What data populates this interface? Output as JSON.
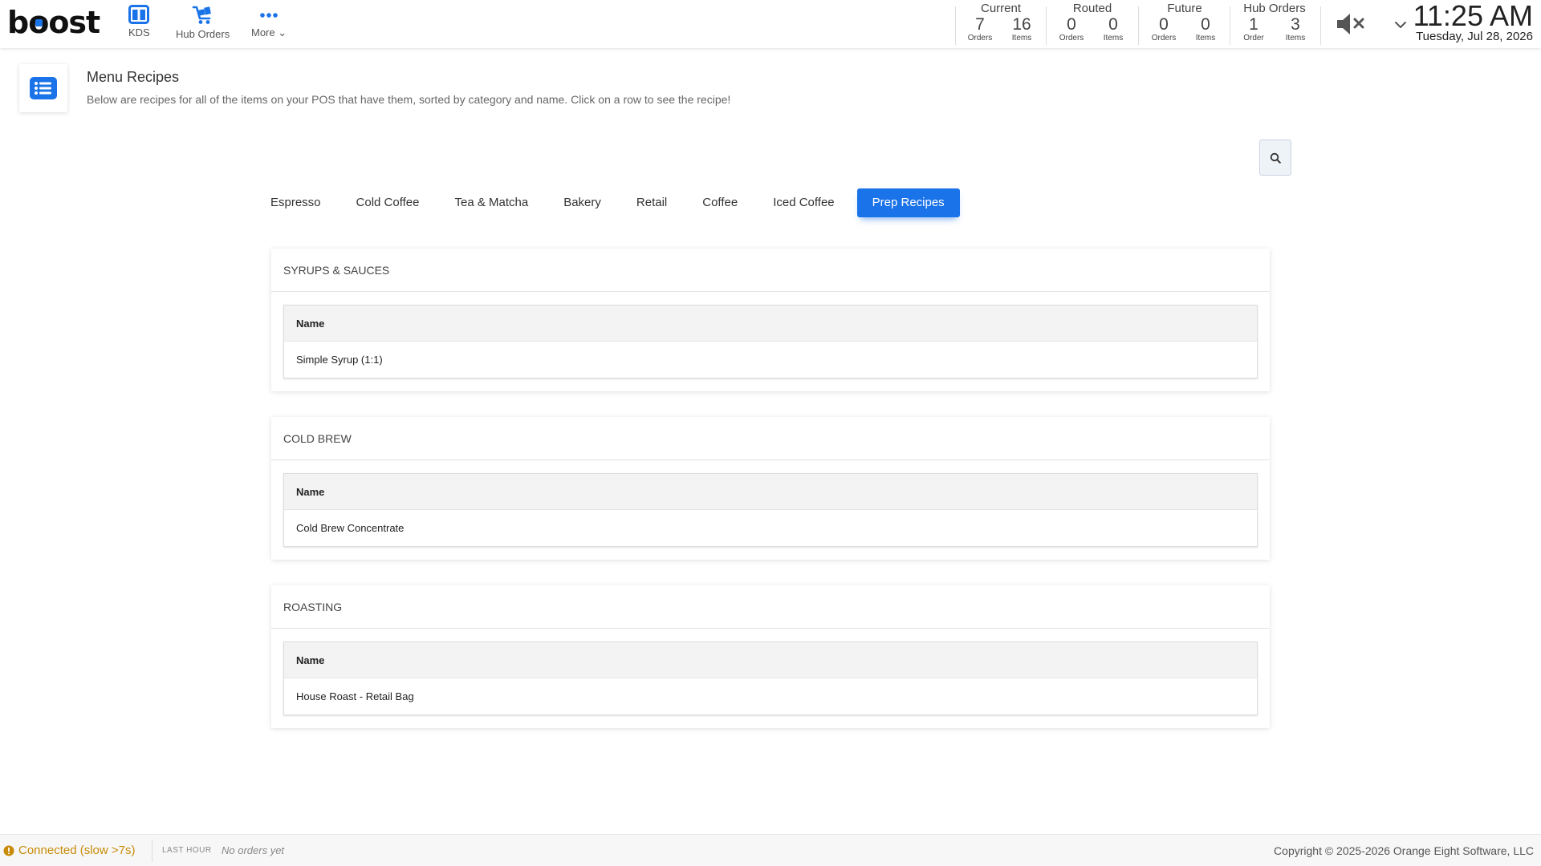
{
  "app": {
    "logo_text": "boost"
  },
  "nav": [
    {
      "label": "KDS",
      "icon": "kds-columns-icon"
    },
    {
      "label": "Hub Orders",
      "icon": "hub-cart-icon"
    },
    {
      "label": "More ⌄",
      "icon": "more-dots-icon"
    }
  ],
  "stats": {
    "current": {
      "title": "Current",
      "a_val": "7",
      "a_sub": "Orders",
      "b_val": "16",
      "b_sub": "Items"
    },
    "routed": {
      "title": "Routed",
      "a_val": "0",
      "a_sub": "Orders",
      "b_val": "0",
      "b_sub": "Items"
    },
    "future": {
      "title": "Future",
      "a_val": "0",
      "a_sub": "Orders",
      "b_val": "0",
      "b_sub": "Items"
    },
    "hub": {
      "title": "Hub Orders",
      "a_val": "1",
      "a_sub": "Order",
      "b_val": "3",
      "b_sub": "Items"
    }
  },
  "clock": {
    "time": "11:25 AM",
    "date": "Tuesday, Jul 28, 2026"
  },
  "header": {
    "title": "Menu Recipes",
    "description": "Below are recipes for all of the items on your POS that have them, sorted by category and name. Click on a row to see the recipe!"
  },
  "tabs": [
    {
      "label": "Espresso",
      "active": false
    },
    {
      "label": "Cold Coffee",
      "active": false
    },
    {
      "label": "Tea & Matcha",
      "active": false
    },
    {
      "label": "Bakery",
      "active": false
    },
    {
      "label": "Retail",
      "active": false
    },
    {
      "label": "Coffee",
      "active": false
    },
    {
      "label": "Iced Coffee",
      "active": false
    },
    {
      "label": "Prep Recipes",
      "active": true
    }
  ],
  "sections": [
    {
      "title": "SYRUPS & SAUCES",
      "column": "Name",
      "rows": [
        "Simple Syrup (1:1)"
      ]
    },
    {
      "title": "COLD BREW",
      "column": "Name",
      "rows": [
        "Cold Brew Concentrate"
      ]
    },
    {
      "title": "ROASTING",
      "column": "Name",
      "rows": [
        "House Roast - Retail Bag"
      ]
    }
  ],
  "footer": {
    "status": "Connected (slow >7s)",
    "last_hour_label": "LAST HOUR",
    "last_hour_value": "No orders yet",
    "copyright": "Copyright © 2025-2026 Orange Eight Software, LLC"
  },
  "colors": {
    "accent": "#1a73e8",
    "warning": "#c88b07"
  }
}
